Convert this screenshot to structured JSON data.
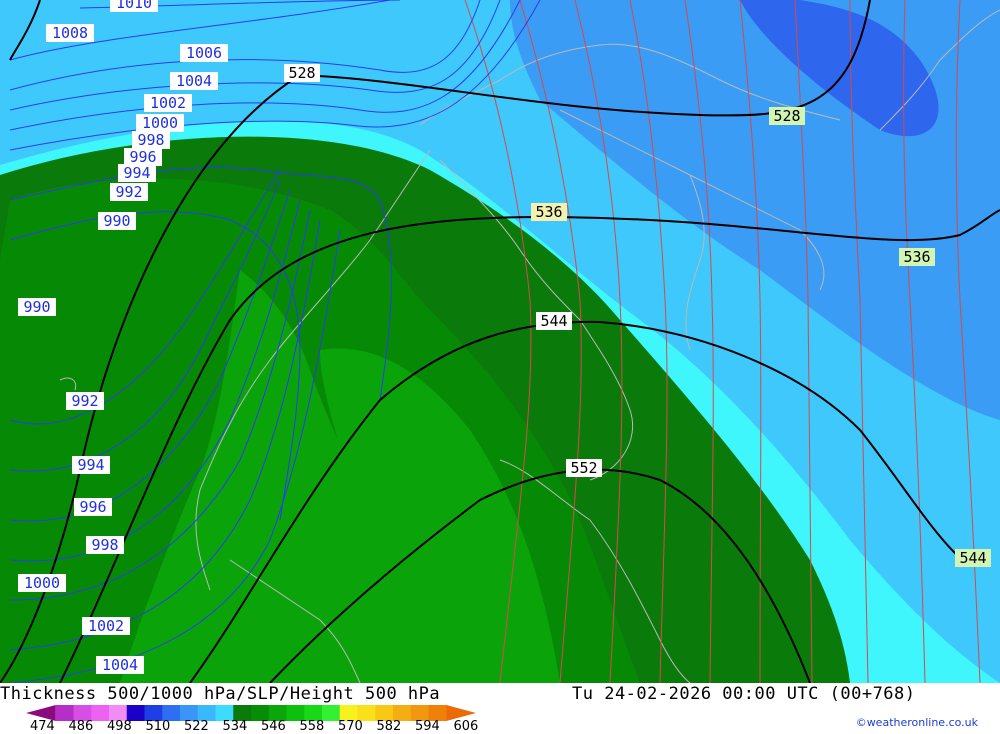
{
  "footer": {
    "title": "Thickness 500/1000 hPa/SLP/Height 500 hPa",
    "datetime": "Tu 24-02-2026 00:00 UTC (00+768)",
    "credit": "©weatheronline.co.uk"
  },
  "legend": {
    "ticks": [
      "474",
      "486",
      "498",
      "510",
      "522",
      "534",
      "546",
      "558",
      "570",
      "582",
      "594",
      "606"
    ],
    "colors": [
      "#8b0a7e",
      "#b52ec8",
      "#d64ee6",
      "#ee62f2",
      "#f08cf4",
      "#1a00c8",
      "#1f3fe6",
      "#2e6ef0",
      "#3a96f6",
      "#39b8fb",
      "#3ddcff",
      "#0a7a0a",
      "#068d06",
      "#0aa60a",
      "#0ec00e",
      "#17d917",
      "#33f033",
      "#f7f21e",
      "#f9e01a",
      "#f8c816",
      "#f5ae12",
      "#f2980e",
      "#ef8108",
      "#ec6a04"
    ]
  },
  "map": {
    "slp_labels": [
      "1010",
      "1008",
      "1006",
      "1004",
      "1002",
      "1000",
      "998",
      "996",
      "994",
      "992",
      "990",
      "990",
      "992",
      "994",
      "996",
      "998",
      "1000",
      "1002",
      "1004"
    ],
    "height_labels": [
      "528",
      "528",
      "536",
      "536",
      "544",
      "544",
      "552"
    ]
  },
  "colors": {
    "slp_isobar": "#2a3cf0",
    "thickness_line": "#d64a4a",
    "height_contour": "#000000",
    "coast": "#b4b4b4"
  }
}
